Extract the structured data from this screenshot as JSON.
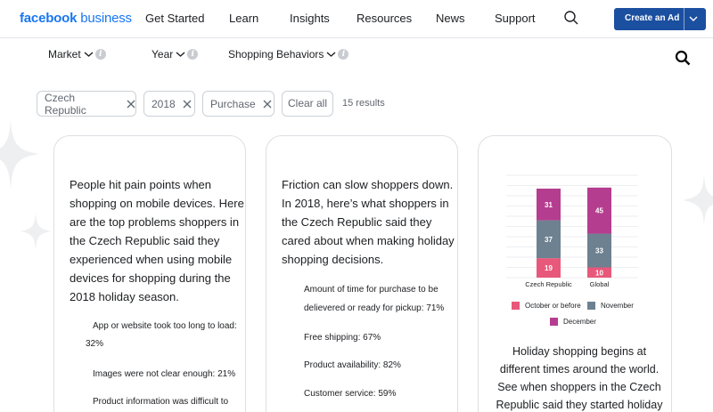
{
  "nav": {
    "brand_bold": "facebook",
    "brand_rest": " business",
    "links": [
      "Get Started",
      "Learn",
      "Insights",
      "Resources",
      "News",
      "Support"
    ],
    "create_ad": "Create an Ad"
  },
  "filters": {
    "items": [
      "Market",
      "Year",
      "Shopping Behaviors"
    ],
    "chips": [
      "Czech Republic",
      "2018",
      "Purchase"
    ],
    "clear_all": "Clear all",
    "results": "15 results"
  },
  "card1": {
    "text": "People hit pain points when shopping on mobile devices. Here are the top problems shoppers in the Czech Republic said they experienced when using mobile devices for shopping during the 2018 holiday season.",
    "lines": [
      "People hit pain points when",
      "shopping on mobile devices. Here",
      "are the top problems shoppers in",
      "the Czech Republic said they",
      "experienced when using mobile",
      "devices for shopping during the",
      "2018 holiday season."
    ],
    "bullets": [
      "App or website took too long to load:",
      "32%",
      "Images were not clear enough: 21%",
      "Product information was difficult to"
    ]
  },
  "card2": {
    "lines": [
      "Friction can slow shoppers down.",
      "In 2018, here’s what shoppers in",
      "the Czech Republic said they",
      "cared about when making holiday",
      "shopping decisions."
    ],
    "bullets": [
      "Amount of time for purchase to be",
      "delievered or ready for pickup: 71%",
      "Free shipping: 67%",
      "Product availability: 82%",
      "Customer service: 59%"
    ]
  },
  "card3": {
    "caption_lines": [
      "Holiday shopping begins at",
      "different times around the world.",
      "See when shoppers in the Czech",
      "Republic said they started holiday"
    ]
  },
  "colors": {
    "october": "#e8587a",
    "november": "#6d8190",
    "december": "#b53d8f",
    "brand": "#1877f2",
    "button": "#1b4fa0"
  },
  "chart_data": {
    "type": "bar",
    "stacked": true,
    "categories": [
      "Czech Republic",
      "Global"
    ],
    "series": [
      {
        "name": "October or before",
        "values": [
          19,
          10
        ]
      },
      {
        "name": "November",
        "values": [
          37,
          33
        ]
      },
      {
        "name": "December",
        "values": [
          31,
          45
        ]
      }
    ],
    "ylim": [
      0,
      100
    ],
    "grid": true,
    "legend": "bottom"
  }
}
